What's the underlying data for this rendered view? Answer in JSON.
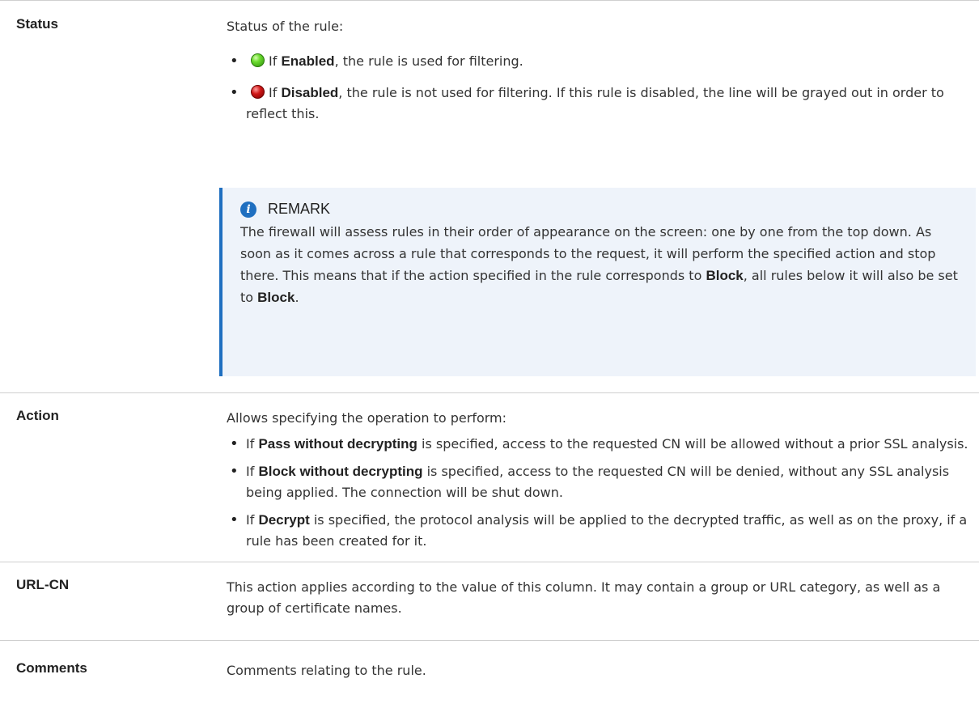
{
  "rows": [
    {
      "term": "Status",
      "intro": "Status of the rule:",
      "bullets": [
        {
          "icon": "green-status-icon",
          "pre": "If ",
          "bold": "Enabled",
          "post": ", the rule is used for filtering."
        },
        {
          "icon": "red-status-icon",
          "pre": "If ",
          "bold": "Disabled",
          "post": ", the rule is not used for filtering. If this rule is disabled, the line will be grayed out in order to reflect this."
        }
      ],
      "remark": {
        "title": "REMARK",
        "text": "The firewall will assess rules in their order of appearance on the screen: one by one from the top down. As soon as it comes across a rule that corresponds to the request, it will perform the specified action and stop there. This means that if the action specified in the rule corresponds to ",
        "bold1": "Block",
        "mid": ", all rules below it will also be set to ",
        "bold2": "Block",
        "end": "."
      }
    },
    {
      "term": "Action",
      "intro": "Allows specifying the operation to perform:",
      "bullets": [
        {
          "pre": "If ",
          "bold": "Pass without decrypting",
          "post": " is specified, access to the requested CN will be allowed without a prior SSL analysis."
        },
        {
          "pre": "If ",
          "bold": "Block without decrypting",
          "post": " is specified, access to the requested CN will be denied, without any SSL analysis being applied. The connection will be shut down."
        },
        {
          "pre": "If ",
          "bold": "Decrypt",
          "post": " is specified, the protocol analysis will be applied to the decrypted traffic, as well as on the proxy, if a rule has been created for it."
        }
      ]
    },
    {
      "term": "URL-CN",
      "text": "This action applies according to the value of this column. It may contain a group or URL category, as well as a group of certificate names."
    },
    {
      "term": "Comments",
      "text": "Comments relating to the rule."
    }
  ]
}
